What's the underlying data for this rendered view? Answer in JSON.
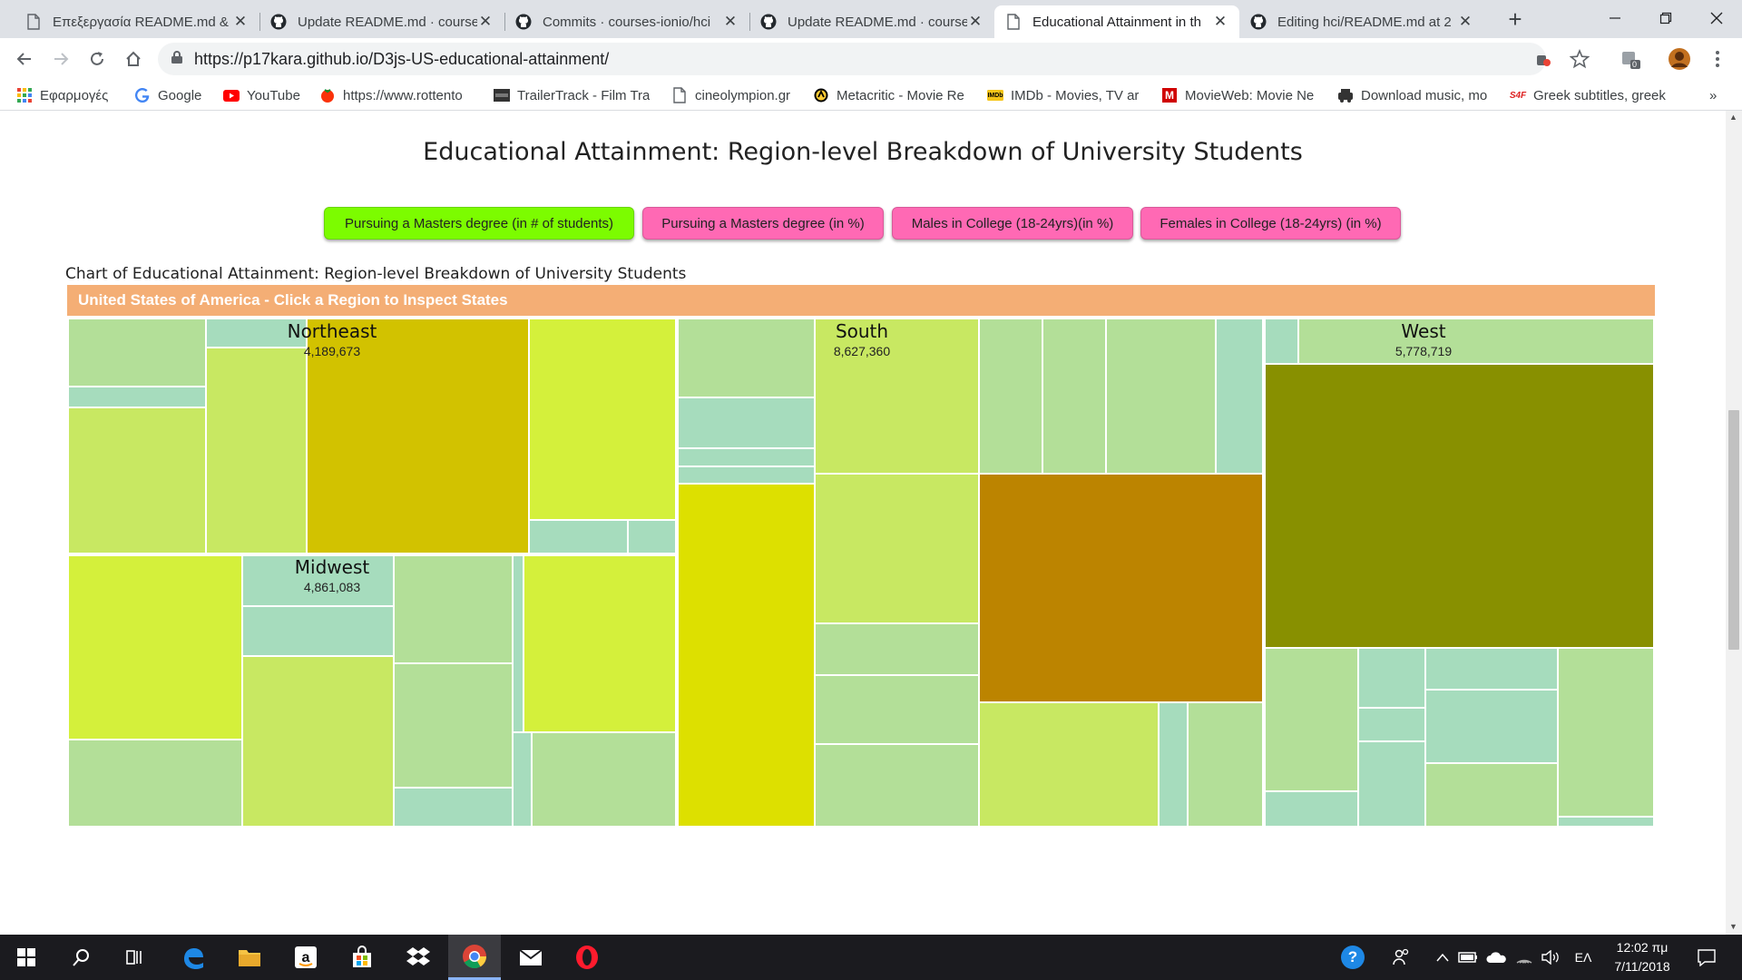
{
  "browser": {
    "tabs": [
      {
        "title": "Επεξεργασία README.md &",
        "icon": "file-icon",
        "active": false
      },
      {
        "title": "Update README.md · course",
        "icon": "github-icon",
        "active": false
      },
      {
        "title": "Commits · courses-ionio/hci",
        "icon": "github-icon",
        "active": false
      },
      {
        "title": "Update README.md · course",
        "icon": "github-icon",
        "active": false
      },
      {
        "title": "Educational Attainment in th",
        "icon": "file-icon",
        "active": true
      },
      {
        "title": "Editing hci/README.md at 2",
        "icon": "github-icon",
        "active": false
      }
    ],
    "tab_close": "✕",
    "new_tab": "+",
    "url": "https://p17kara.github.io/D3js-US-educational-attainment/",
    "extension_badge": "0",
    "bookmarks": [
      {
        "label": "Εφαρμογές",
        "icon": "apps-grid-icon"
      },
      {
        "label": "Google",
        "icon": "google-icon"
      },
      {
        "label": "YouTube",
        "icon": "youtube-icon"
      },
      {
        "label": "https://www.rottento",
        "icon": "tomato-icon"
      },
      {
        "label": "TrailerTrack - Film Tra",
        "icon": "trailertrack-icon"
      },
      {
        "label": "cineolympion.gr",
        "icon": "file-icon"
      },
      {
        "label": "Metacritic - Movie Re",
        "icon": "metacritic-icon"
      },
      {
        "label": "IMDb - Movies, TV ar",
        "icon": "imdb-icon"
      },
      {
        "label": "MovieWeb: Movie Ne",
        "icon": "movieweb-icon"
      },
      {
        "label": "Download music, mo",
        "icon": "download-icon"
      },
      {
        "label": "Greek subtitles, greek",
        "icon": "s4f-icon"
      }
    ],
    "bookmarks_overflow": "»",
    "icon_text": {
      "imdb": "IMDb",
      "s4f": "S4F",
      "youtube": "▶",
      "movieweb": "M",
      "metacritic": "◎"
    }
  },
  "page": {
    "title": "Educational Attainment: Region-level Breakdown of University Students",
    "buttons": [
      {
        "label": "Pursuing a Masters degree (in # of students)",
        "color": "#7cfc00",
        "selected": true
      },
      {
        "label": "Pursuing a Masters degree (in %)",
        "color": "#ff69b4",
        "selected": false
      },
      {
        "label": "Males in College (18-24yrs)(in %)",
        "color": "#ff69b4",
        "selected": false
      },
      {
        "label": "Females in College (18-24yrs) (in %)",
        "color": "#ff69b4",
        "selected": false
      }
    ],
    "chart_caption": "Chart of Educational Attainment: Region-level Breakdown of University Students",
    "chart_header": "United States of America - Click a Region to Inspect States",
    "header_color": "#f4ae75"
  },
  "chart_data": {
    "type": "treemap",
    "root": "United States of America",
    "regions": [
      {
        "name": "Northeast",
        "value": "4,189,673"
      },
      {
        "name": "Midwest",
        "value": "4,861,083"
      },
      {
        "name": "South",
        "value": "8,627,360"
      },
      {
        "name": "West",
        "value": "5,778,719"
      }
    ],
    "colors": {
      "tiny": "#a6dcbd",
      "light": "#b3df98",
      "lime": "#c8e862",
      "bright": "#d4f03b",
      "yellow": "#dde000",
      "gold": "#d2c200",
      "orange": "#bc8400",
      "olive": "#889000"
    }
  },
  "taskbar": {
    "language": "ΕΛ",
    "time": "12:02 πμ",
    "date": "7/11/2018",
    "help": "?"
  }
}
